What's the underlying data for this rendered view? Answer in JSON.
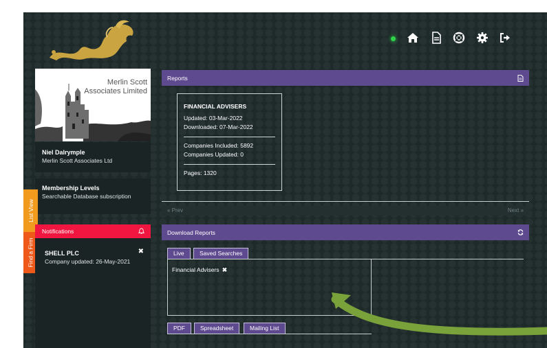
{
  "company": {
    "name": "Merlin Scott Associates Limited"
  },
  "user": {
    "name": "Niel Dalrymple",
    "company": "Merlin Scott Associates Ltd"
  },
  "membership": {
    "title": "Membership Levels",
    "level": "Searchable Database subscription"
  },
  "side_tabs": {
    "list_view": "List View",
    "find_firm": "Find a Firm"
  },
  "notifications": {
    "title": "Notifications",
    "items": [
      {
        "company": "SHELL PLC",
        "text": "Company updated: 26-May-2021"
      }
    ]
  },
  "reports": {
    "title": "Reports",
    "card": {
      "title": "FINANCIAL ADVISERS",
      "updated": "Updated: 03-Mar-2022",
      "downloaded": "Downloaded: 07-Mar-2022",
      "companies_included": "Companies Included: 5892",
      "companies_updated": "Companies Updated: 0",
      "pages": "Pages: 1320"
    },
    "prev": "« Prev",
    "next": "Next »"
  },
  "download": {
    "title": "Download Reports",
    "tabs": [
      "Live",
      "Saved Searches"
    ],
    "selected_chip": "Financial Advisers",
    "chip_remove": "✖",
    "export_tabs": [
      "PDF",
      "Spreadsheet",
      "Mailing List"
    ]
  },
  "header_icons": [
    "status-dot",
    "home-icon",
    "document-icon",
    "lifebuoy-icon",
    "gear-icon",
    "sign-out-icon"
  ],
  "colors": {
    "accent_purple": "#5e4a8f",
    "notification_red": "#f0163f",
    "list_view_orange": "#f29a1e",
    "find_firm_orange": "#ef5a1b",
    "status_green": "#2fd34a",
    "background": "#1e2a2a"
  }
}
